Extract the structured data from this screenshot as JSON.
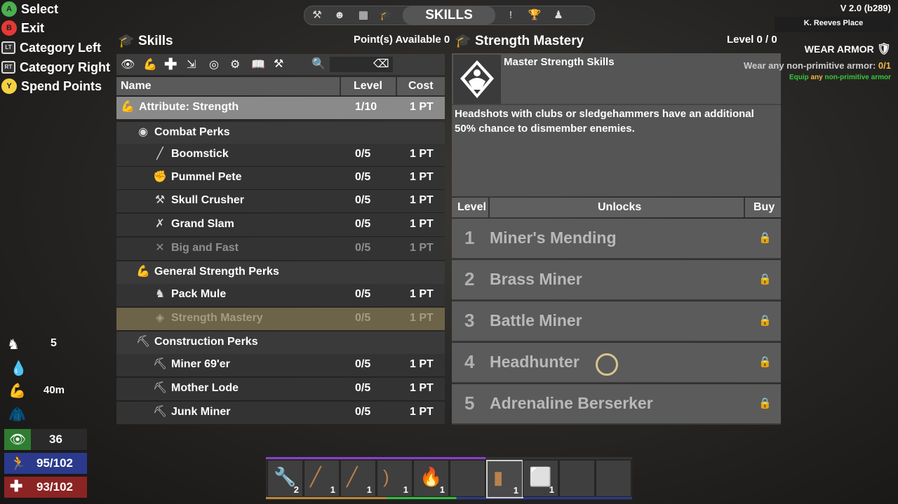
{
  "nav": {
    "title": "SKILLS",
    "icons": [
      "hammer-icon",
      "character-icon",
      "map-icon",
      "skills-cap-icon",
      "challenge-icon",
      "trophy-icon",
      "players-icon"
    ]
  },
  "version": "V 2.0 (b289)",
  "location": "K. Reeves Place",
  "controls": [
    {
      "button": "A",
      "label": "Select",
      "color": "#4caf50"
    },
    {
      "button": "B",
      "label": "Exit",
      "color": "#e53935"
    },
    {
      "button": "LT",
      "label": "Category Left",
      "color": "#dddddd"
    },
    {
      "button": "RT",
      "label": "Category Right",
      "color": "#dddddd"
    },
    {
      "button": "Y",
      "label": "Spend Points",
      "color": "#f5d142"
    }
  ],
  "skills_panel": {
    "title": "Skills",
    "points": "Point(s) Available 0",
    "columns": {
      "name": "Name",
      "level": "Level",
      "cost": "Cost"
    },
    "rows": [
      {
        "type": "attr",
        "name": "Attribute: Strength",
        "level": "1/10",
        "cost": "1 PT",
        "icon": "bicep-icon",
        "glyph": "💪"
      },
      {
        "type": "cat",
        "name": "Combat Perks",
        "icon": "combat-icon",
        "glyph": "◉"
      },
      {
        "type": "perk",
        "name": "Boomstick",
        "level": "0/5",
        "cost": "1 PT",
        "icon": "shotgun-icon",
        "glyph": "╱"
      },
      {
        "type": "perk",
        "name": "Pummel Pete",
        "level": "0/5",
        "cost": "1 PT",
        "icon": "fist-icon",
        "glyph": "✊"
      },
      {
        "type": "perk",
        "name": "Skull Crusher",
        "level": "0/5",
        "cost": "1 PT",
        "icon": "sledgehammer-icon",
        "glyph": "⚒"
      },
      {
        "type": "perk",
        "name": "Grand Slam",
        "level": "0/5",
        "cost": "1 PT",
        "icon": "bat-icon",
        "glyph": "✗"
      },
      {
        "type": "perk dim",
        "name": "Big and Fast",
        "level": "0/5",
        "cost": "1 PT",
        "icon": "crossed-weapons-icon",
        "glyph": "✕"
      },
      {
        "type": "cat",
        "name": "General Strength Perks",
        "icon": "bicep-icon",
        "glyph": "💪"
      },
      {
        "type": "perk",
        "name": "Pack Mule",
        "level": "0/5",
        "cost": "1 PT",
        "icon": "pack-mule-icon",
        "glyph": "♞"
      },
      {
        "type": "perk sel",
        "name": "Strength Mastery",
        "level": "0/5",
        "cost": "1 PT",
        "icon": "mastery-icon",
        "glyph": "◈"
      },
      {
        "type": "cat",
        "name": "Construction Perks",
        "icon": "construction-icon",
        "glyph": "⛏"
      },
      {
        "type": "perk",
        "name": "Miner 69'er",
        "level": "0/5",
        "cost": "1 PT",
        "icon": "pickaxe-icon",
        "glyph": "⛏"
      },
      {
        "type": "perk",
        "name": "Mother Lode",
        "level": "0/5",
        "cost": "1 PT",
        "icon": "ore-icon",
        "glyph": "⛏"
      },
      {
        "type": "perk",
        "name": "Junk Miner",
        "level": "0/5",
        "cost": "1 PT",
        "icon": "junk-icon",
        "glyph": "⛏"
      }
    ]
  },
  "detail": {
    "title": "Strength Mastery",
    "level": "Level 0 / 0",
    "subtitle": "Master Strength Skills",
    "description": "Headshots with clubs or sledgehammers have an additional 50% chance to dismember enemies.",
    "columns": {
      "level": "Level",
      "unlocks": "Unlocks",
      "buy": "Buy"
    },
    "unlocks": [
      {
        "n": "1",
        "name": "Miner's Mending"
      },
      {
        "n": "2",
        "name": "Brass Miner"
      },
      {
        "n": "3",
        "name": "Battle Miner"
      },
      {
        "n": "4",
        "name": "Headhunter"
      },
      {
        "n": "5",
        "name": "Adrenaline Berserker"
      }
    ]
  },
  "quest": {
    "title": "WEAR ARMOR",
    "line1_a": "Wear any non-primitive armor: ",
    "line1_b": "0/1",
    "line2_a": "Equip ",
    "line2_b": "any",
    "line2_c": " non-primitive armor"
  },
  "stats": {
    "level": "5",
    "time": "40m",
    "perception": "36",
    "stamina": "95/102",
    "health": "93/102",
    "colors": {
      "perception": "#2e7d32",
      "stamina": "#2b3a8c",
      "health": "#8c2424"
    }
  },
  "toolbelt": [
    {
      "count": "2",
      "icon": "wrench-icon",
      "glyph": "🔧"
    },
    {
      "count": "1",
      "icon": "stone-spear-icon",
      "glyph": "╱"
    },
    {
      "count": "1",
      "icon": "club-icon",
      "glyph": "╱"
    },
    {
      "count": "1",
      "icon": "bow-icon",
      "glyph": ")"
    },
    {
      "count": "1",
      "icon": "torch-icon",
      "glyph": "🔥"
    },
    {
      "count": "",
      "icon": "",
      "glyph": ""
    },
    {
      "count": "1",
      "icon": "jar-icon",
      "glyph": "▮"
    },
    {
      "count": "1",
      "icon": "block-icon",
      "glyph": "⬜"
    },
    {
      "count": "",
      "icon": "",
      "glyph": ""
    },
    {
      "count": "",
      "icon": "",
      "glyph": ""
    }
  ]
}
